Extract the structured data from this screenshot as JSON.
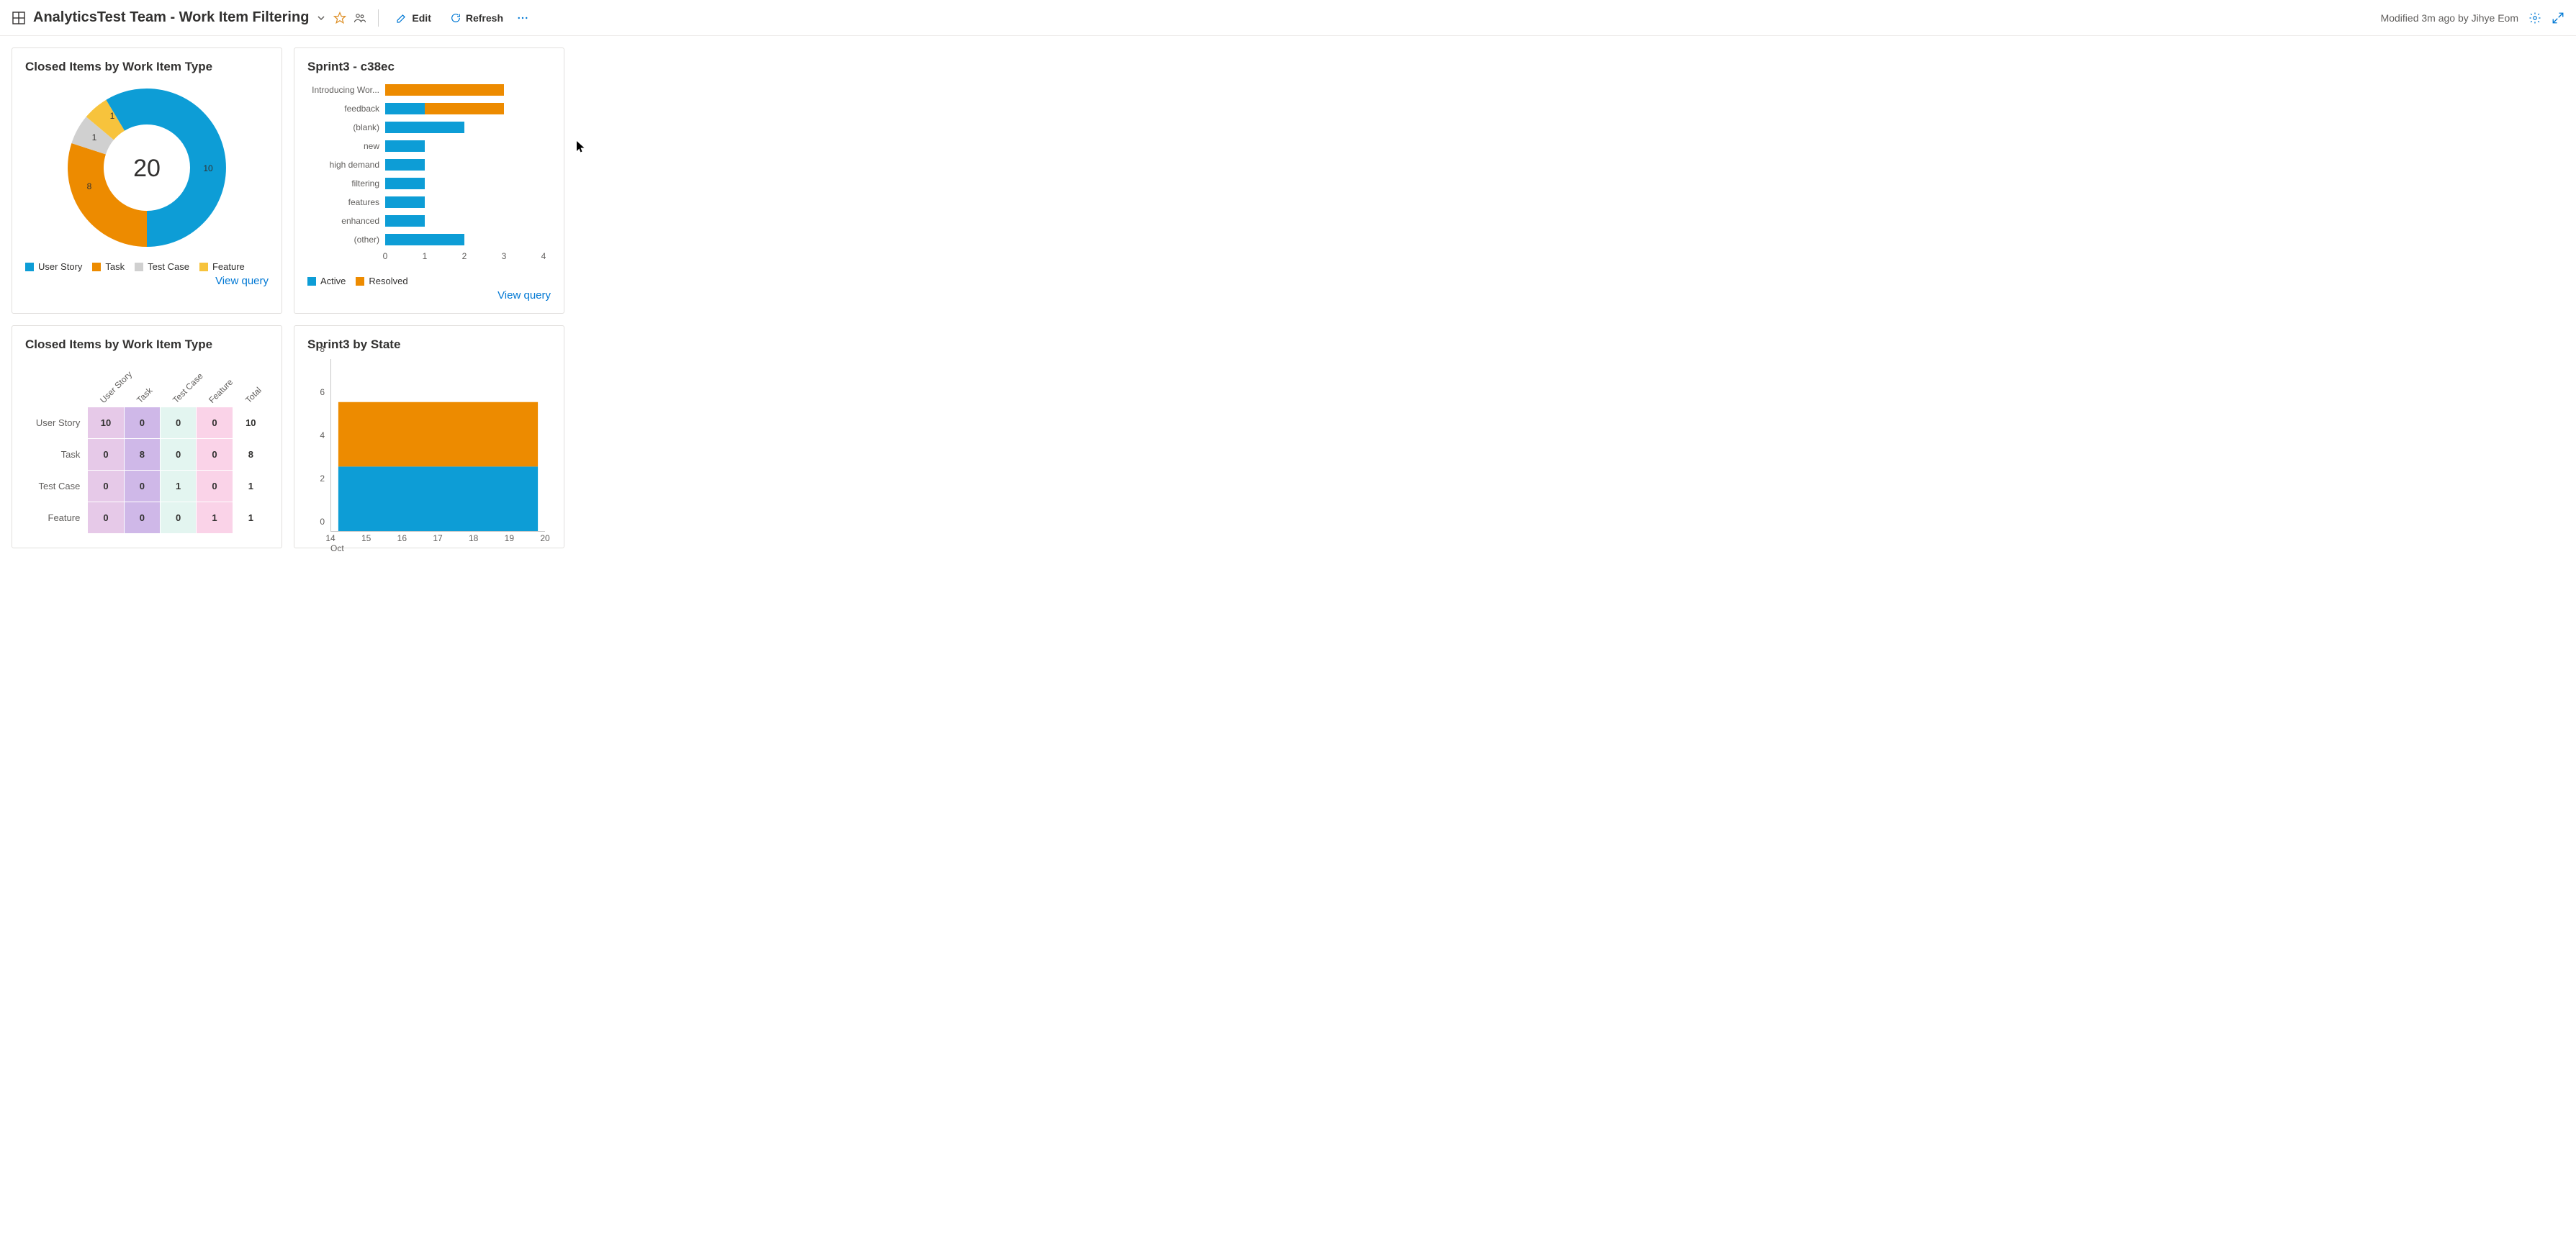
{
  "header": {
    "title": "AnalyticsTest Team - Work Item Filtering",
    "edit_label": "Edit",
    "refresh_label": "Refresh",
    "modified_text": "Modified 3m ago by Jihye Eom"
  },
  "colors": {
    "blue": "#0d9dd6",
    "orange": "#ed8b00",
    "gray": "#d0d0d0",
    "yellow": "#f7c33c",
    "link": "#0078d4"
  },
  "widget1": {
    "title": "Closed Items by Work Item Type",
    "center_value": "20",
    "legend": [
      {
        "label": "User Story",
        "color": "#0d9dd6"
      },
      {
        "label": "Task",
        "color": "#ed8b00"
      },
      {
        "label": "Test Case",
        "color": "#d0d0d0"
      },
      {
        "label": "Feature",
        "color": "#f7c33c"
      }
    ],
    "slice_labels": {
      "user_story": "10",
      "task": "8",
      "test_case": "1",
      "feature": "1"
    },
    "view_query": "View query"
  },
  "widget2": {
    "title": "Sprint3 - c38ec",
    "legend": [
      {
        "label": "Active",
        "color": "#0d9dd6"
      },
      {
        "label": "Resolved",
        "color": "#ed8b00"
      }
    ],
    "x_ticks": [
      "0",
      "1",
      "2",
      "3",
      "4"
    ],
    "view_query": "View query"
  },
  "widget3": {
    "title": "Closed Items by Work Item Type",
    "col_headers": [
      "User Story",
      "Task",
      "Test Case",
      "Feature",
      "Total"
    ],
    "rows": [
      {
        "label": "User Story",
        "cells": [
          "10",
          "0",
          "0",
          "0",
          "10"
        ]
      },
      {
        "label": "Task",
        "cells": [
          "0",
          "8",
          "0",
          "0",
          "8"
        ]
      },
      {
        "label": "Test Case",
        "cells": [
          "0",
          "0",
          "1",
          "0",
          "1"
        ]
      },
      {
        "label": "Feature",
        "cells": [
          "0",
          "0",
          "0",
          "1",
          "1"
        ]
      }
    ],
    "col_colors": [
      "#e6c9e8",
      "#cfb8e8",
      "#e3f5f0",
      "#fad3e8",
      "#ffffff"
    ]
  },
  "widget4": {
    "title": "Sprint3 by State",
    "y_ticks": [
      "0",
      "2",
      "4",
      "6",
      "8"
    ],
    "x_ticks": [
      "14",
      "15",
      "16",
      "17",
      "18",
      "19",
      "20"
    ],
    "x_sublabel": "Oct"
  },
  "chart_data": [
    {
      "type": "pie",
      "title": "Closed Items by Work Item Type",
      "categories": [
        "User Story",
        "Task",
        "Test Case",
        "Feature"
      ],
      "values": [
        10,
        8,
        1,
        1
      ],
      "total": 20
    },
    {
      "type": "bar",
      "title": "Sprint3 - c38ec",
      "orientation": "horizontal",
      "categories": [
        "Introducing Wor...",
        "feedback",
        "(blank)",
        "new",
        "high demand",
        "filtering",
        "features",
        "enhanced",
        "(other)"
      ],
      "series": [
        {
          "name": "Active",
          "values": [
            0,
            1,
            2,
            1,
            1,
            1,
            1,
            1,
            2
          ]
        },
        {
          "name": "Resolved",
          "values": [
            3,
            2,
            0,
            0,
            0,
            0,
            0,
            0,
            0
          ]
        }
      ],
      "xlim": [
        0,
        4
      ]
    },
    {
      "type": "heatmap",
      "title": "Closed Items by Work Item Type",
      "row_labels": [
        "User Story",
        "Task",
        "Test Case",
        "Feature"
      ],
      "col_labels": [
        "User Story",
        "Task",
        "Test Case",
        "Feature",
        "Total"
      ],
      "matrix": [
        [
          10,
          0,
          0,
          0,
          10
        ],
        [
          0,
          8,
          0,
          0,
          8
        ],
        [
          0,
          0,
          1,
          0,
          1
        ],
        [
          0,
          0,
          0,
          1,
          1
        ]
      ]
    },
    {
      "type": "area",
      "title": "Sprint3 by State",
      "x": [
        14,
        15,
        16,
        17,
        18,
        19,
        20
      ],
      "series": [
        {
          "name": "Active",
          "values": [
            3,
            3,
            3,
            3,
            3,
            3,
            3
          ]
        },
        {
          "name": "Resolved",
          "values": [
            3,
            3,
            3,
            3,
            3,
            3,
            3
          ]
        }
      ],
      "stacked": true,
      "ylim": [
        0,
        8
      ],
      "xlabel": "Oct"
    }
  ]
}
